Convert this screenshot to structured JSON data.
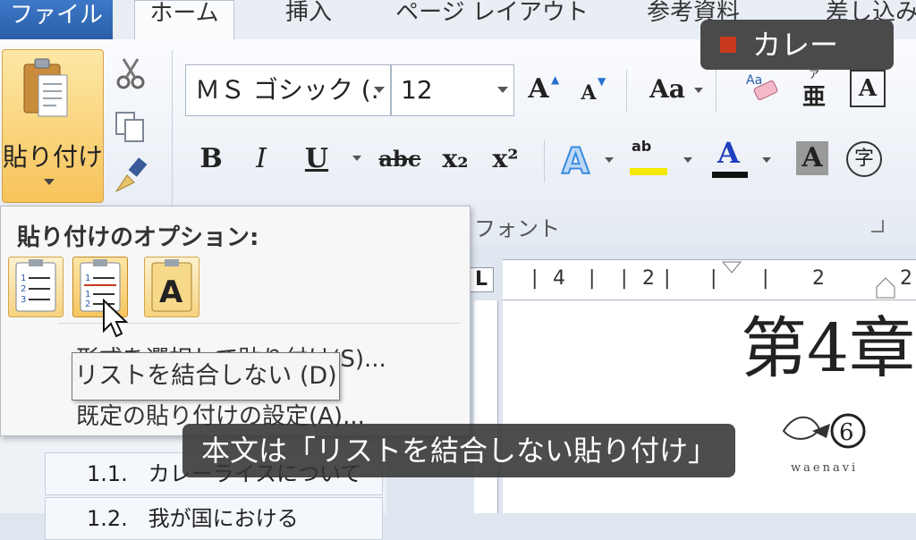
{
  "ribbon_tabs": {
    "file": "ファイル",
    "home": "ホーム",
    "insert": "挿入",
    "page_layout": "ページ レイアウト",
    "references": "参考資料",
    "mailings": "差し込み"
  },
  "clipboard": {
    "paste_label": "貼り付け"
  },
  "font": {
    "font_name": "ＭＳ ゴシック (.",
    "font_size": "12",
    "group_label": "フォント",
    "case_label": "Aa",
    "bold_label": "B",
    "italic_label": "I",
    "underline_label": "U",
    "strike_label": "abc",
    "sub_label": "x₂",
    "sup_label": "x²",
    "grow_label": "A",
    "shrink_label": "A",
    "font_color_label": "A",
    "char_shade_label": "A",
    "enclose_label": "字",
    "phonetic_top": "ア",
    "phonetic_bottom": "亜",
    "border_label": "A",
    "highlight_label": "ab",
    "font_color_hex": "#1f3fbf",
    "highlight_hex": "#f5e800"
  },
  "chip": {
    "label": "カレー",
    "square_color": "#c8391e"
  },
  "paste_menu": {
    "title": "貼り付けのオプション:",
    "item_paste_special": "形式を選択して貼り付け(S)...",
    "item_default": "既定の貼り付けの設定(A)..."
  },
  "tooltip": {
    "text": "リストを結合しない (D)"
  },
  "ruler": {
    "nums": [
      "4",
      "2",
      "2",
      "2"
    ],
    "tabstop": "L"
  },
  "document": {
    "heading": "第4章"
  },
  "nav": {
    "item1": "1.1.   カレーライスについて",
    "item2": "1.2.   我が国における"
  },
  "subtitle": {
    "text": "本文は「リストを結合しない貼り付け」"
  },
  "logo": {
    "wordmark": "waenavi"
  }
}
